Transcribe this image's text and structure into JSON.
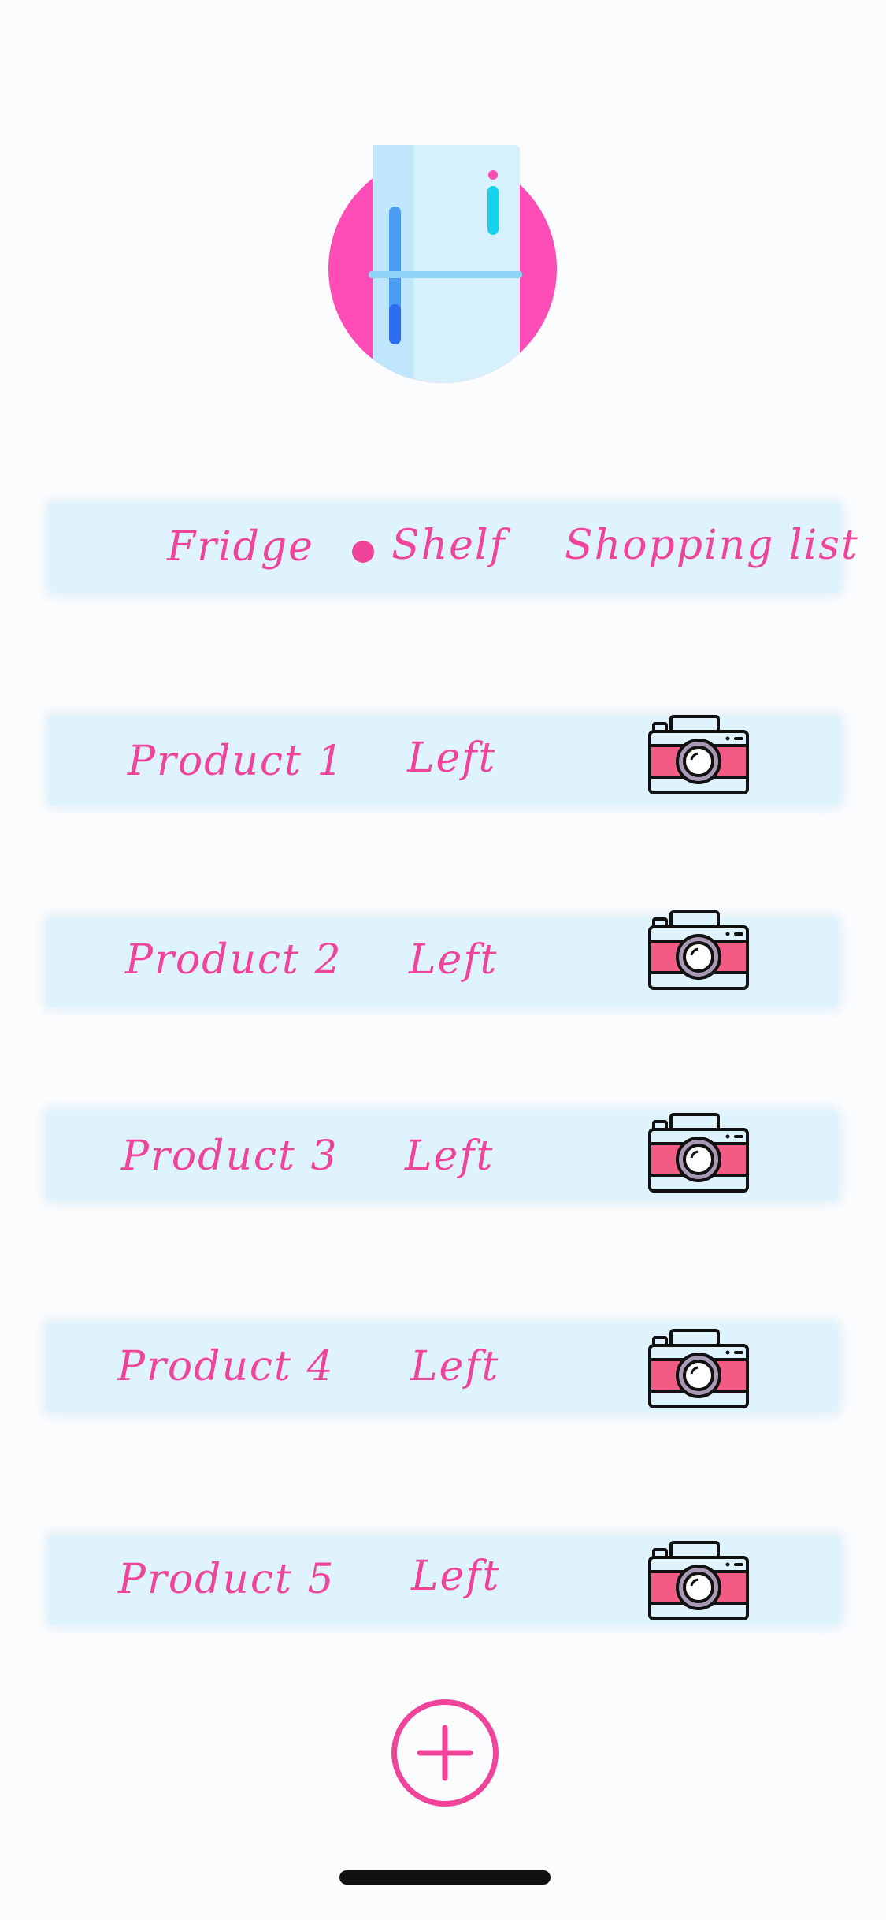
{
  "app": {
    "logo_icon": "fridge-icon",
    "accent_color": "#f0449a",
    "bar_color": "#dff3fd"
  },
  "tabs": [
    {
      "label": "Fridge",
      "selected": false
    },
    {
      "label": "Shelf",
      "selected": true
    },
    {
      "label": "Shopping list",
      "selected": false
    }
  ],
  "products": [
    {
      "name": "Product 1",
      "status": "Left",
      "icon": "camera-icon"
    },
    {
      "name": "Product 2",
      "status": "Left",
      "icon": "camera-icon"
    },
    {
      "name": "Product 3",
      "status": "Left",
      "icon": "camera-icon"
    },
    {
      "name": "Product 4",
      "status": "Left",
      "icon": "camera-icon"
    },
    {
      "name": "Product 5",
      "status": "Left",
      "icon": "camera-icon"
    }
  ],
  "add_button": {
    "icon": "plus-icon"
  }
}
